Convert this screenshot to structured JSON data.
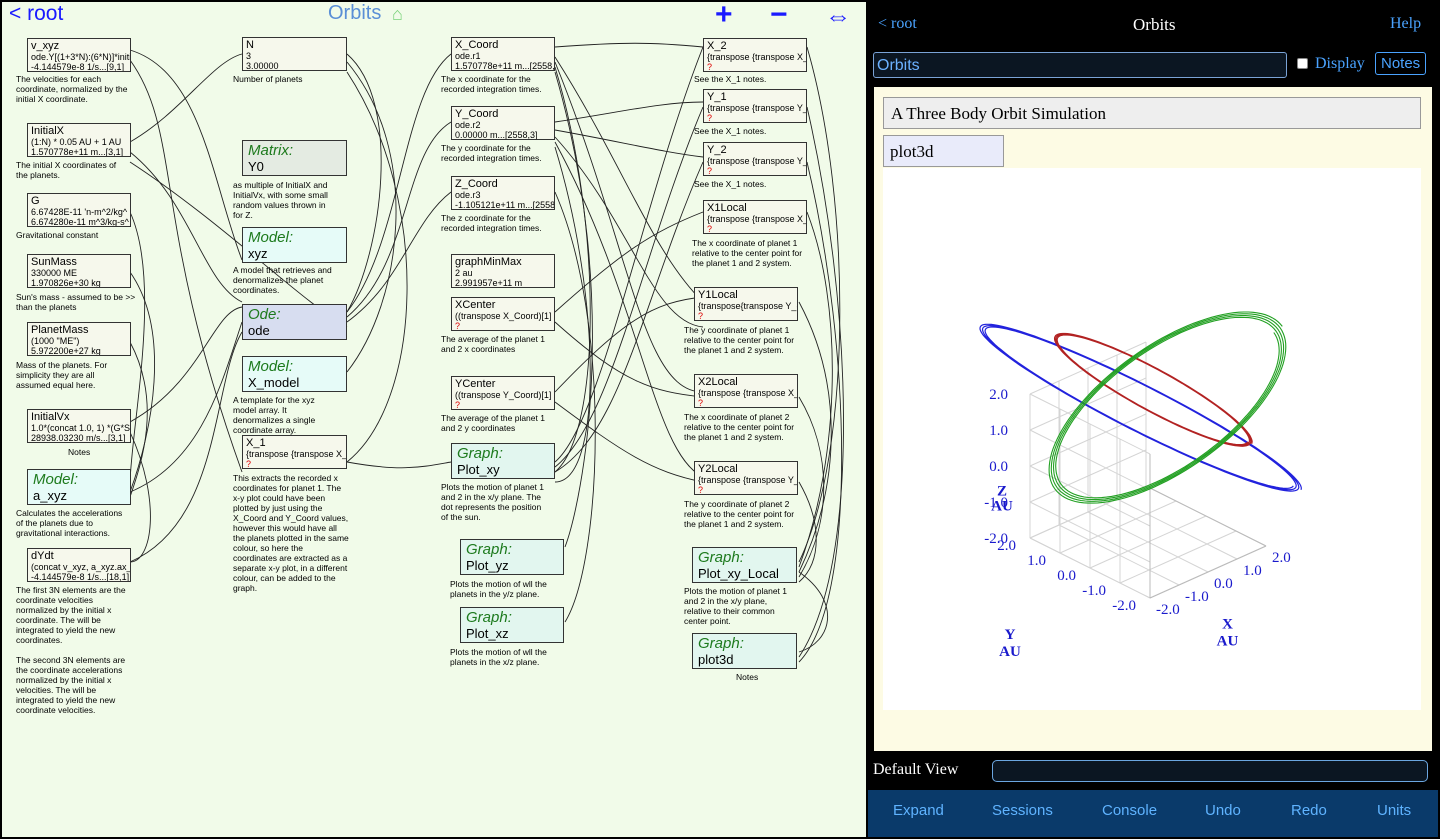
{
  "diagram": {
    "root_link": "< root",
    "title": "Orbits",
    "home_icon": "house-icon",
    "zoom_in": "+",
    "zoom_out": "−",
    "expand": "⇔",
    "nodes": {
      "v_xyz": {
        "name": "v_xyz",
        "l1": "ode.Y[(1+3*N):(6*N)]*initi",
        "l2": "-4.144579e-8 1/s...[9,1]",
        "note": "The velocities for each coordinate, normalized by the initial X coordinate."
      },
      "initialx": {
        "name": "InitialX",
        "l1": "(1:N) * 0.05 AU + 1 AU",
        "l2": "1.570778e+11 m...[3,1]",
        "note": "The initial X coordinates of the planets."
      },
      "g": {
        "name": "G",
        "l1": "6.67428E-11 'n-m^2/kg^",
        "l2": "6.674280e-11 m^3/kg-s^",
        "note": "Gravitational constant"
      },
      "sunmass": {
        "name": "SunMass",
        "l1": "330000 ME",
        "l2": "1.970826e+30 kg",
        "note": "Sun's mass - assumed to be >> than the planets"
      },
      "planetmass": {
        "name": "PlanetMass",
        "l1": "(1000 \"ME\")",
        "l2": "5.972200e+27 kg",
        "note": "Mass of the planets. For simplicity they are all assumed equal here."
      },
      "initialvx": {
        "name": "InitialVx",
        "l1": "1.0*(concat 1.0, 1) *(G*Su",
        "l2": "28938.03230 m/s...[3,1]",
        "note": "Notes"
      },
      "a_xyz": {
        "kind": "Model:",
        "name": "a_xyz",
        "note": "Calculates the accelerations of the planets due to gravitational interactions."
      },
      "dydt": {
        "name": "dYdt",
        "l1": "(concat v_xyz, a_xyz.ax_",
        "l2": "-4.144579e-8 1/s...[18,1]",
        "note": "The first 3N elements are the coordinate velocities normalized by the initial x coordinate. The will be integrated to yield the new coordinates.\n\nThe second 3N elements are the coordinate accelerations normalized by the initial x velocities. The will be integrated to yield the new coordinate velocities."
      },
      "n": {
        "name": "N",
        "l1": "3",
        "l2": "3.00000",
        "note": "Number of planets"
      },
      "y0": {
        "kind": "Matrix:",
        "name": "Y0",
        "note": "as multiple of InitialX and InitialVx, with some small random values thrown in for Z."
      },
      "xyz": {
        "kind": "Model:",
        "name": "xyz",
        "note": "A model that retrieves and denormalizes the planet coordinates."
      },
      "ode": {
        "kind": "Ode:",
        "name": "ode"
      },
      "x_model": {
        "kind": "Model:",
        "name": "X_model",
        "note": "A template for the xyz model array. It denormalizes a single coordinate array."
      },
      "x_1": {
        "name": "X_1",
        "l1": "{transpose {transpose X_",
        "q": "?",
        "note": "This extracts the recorded x coordinates for planet 1. The x-y plot could have been plotted by just using the X_Coord and Y_Coord values, however this would have all the planets plotted in the same colour, so here the coordinates are extracted as a separate x-y plot, in a different colour, can be added to the graph."
      },
      "x_coord": {
        "name": "X_Coord",
        "l1": "ode.r1",
        "l2": "1.570778e+11 m...[2558,",
        "note": "The x coordinate for the recorded integration times."
      },
      "y_coord": {
        "name": "Y_Coord",
        "l1": "ode.r2",
        "l2": "0.00000 m...[2558,3]",
        "note": "The y coordinate for the recorded integration times."
      },
      "z_coord": {
        "name": "Z_Coord",
        "l1": "ode.r3",
        "l2": "-1.105121e+11 m...[2558",
        "note": "The z coordinate for the recorded integration times."
      },
      "graphminmax": {
        "name": "graphMinMax",
        "l1": "2 au",
        "l2": "2.991957e+11 m"
      },
      "xcenter": {
        "name": "XCenter",
        "l1": "((transpose X_Coord)[1]",
        "q": "?",
        "note": "The average of the planet 1 and 2 x coordinates"
      },
      "ycenter": {
        "name": "YCenter",
        "l1": "((transpose Y_Coord)[1]",
        "q": "?",
        "note": "The average of the planet 1 and 2 y coordinates"
      },
      "plot_xy": {
        "kind": "Graph:",
        "name": "Plot_xy",
        "note": "Plots the motion of planet 1 and 2 in the x/y plane. The dot represents the position of the sun."
      },
      "plot_yz": {
        "kind": "Graph:",
        "name": "Plot_yz",
        "note": "Plots the motion of wll the planets in the y/z plane."
      },
      "plot_xz": {
        "kind": "Graph:",
        "name": "Plot_xz",
        "note": "Plots the motion of wll the planets in the x/z plane."
      },
      "x_2": {
        "name": "X_2",
        "l1": "{transpose {transpose X_(",
        "q": "?",
        "note": "See the X_1 notes."
      },
      "y_1": {
        "name": "Y_1",
        "l1": "{transpose {transpose Y_(",
        "q": "?",
        "note": "See the X_1 notes."
      },
      "y_2": {
        "name": "Y_2",
        "l1": "{transpose {transpose Y_(",
        "q": "?",
        "note": "See the X_1 notes."
      },
      "x1local": {
        "name": "X1Local",
        "l1": "{transpose {transpose X_(",
        "q": "?",
        "note": "The x coordinate of planet 1 relative to the center point for the planet 1 and 2 system."
      },
      "y1local": {
        "name": "Y1Local",
        "l1": "{transpose{transpose Y_(",
        "q": "?",
        "note": "The y coordinate of planet 1 relative to the center point for the planet 1 and 2 system."
      },
      "x2local": {
        "name": "X2Local",
        "l1": "{transpose {transpose X_(",
        "q": "?",
        "note": "The x coordinate of planet 2 relative to the center point for the planet 1 and 2 system."
      },
      "y2local": {
        "name": "Y2Local",
        "l1": "{transpose {transpose Y_(",
        "q": "?",
        "note": "The y coordinate of planet 2 relative to the center point for the planet 1 and 2 system."
      },
      "plot_xy_local": {
        "kind": "Graph:",
        "name": "Plot_xy_Local",
        "note": "Plots the motion of planet 1 and 2 in the x/y plane, relative to their common center point."
      },
      "plot3d": {
        "kind": "Graph:",
        "name": "plot3d",
        "note": "Notes"
      }
    }
  },
  "panel": {
    "root_link": "< root",
    "title": "Orbits",
    "help": "Help",
    "title_field": "Orbits",
    "display_label": "Display",
    "display_checked": false,
    "notes_button": "Notes",
    "doc_title": "A Three Body Orbit Simulation",
    "plot_tab": "plot3d",
    "default_view_label": "Default View",
    "default_view_value": "",
    "bottom": {
      "expand": "Expand",
      "sessions": "Sessions",
      "console": "Console",
      "undo": "Undo",
      "redo": "Redo",
      "units": "Units"
    }
  },
  "chart_data": {
    "type": "3d-line",
    "z_ticks": [
      "2.0",
      "1.0",
      "0.0",
      "-1.0",
      "-2.0"
    ],
    "y_ticks": [
      "2.0",
      "1.0",
      "0.0",
      "-1.0",
      "-2.0"
    ],
    "x_ticks": [
      "-2.0",
      "-1.0",
      "0.0",
      "1.0",
      "2.0"
    ],
    "zlabel": [
      "Z",
      "AU"
    ],
    "ylabel": [
      "Y",
      "AU"
    ],
    "xlabel": [
      "X",
      "AU"
    ],
    "series_colors": [
      "#2222dd",
      "#b22222",
      "#22a022"
    ],
    "axis_label_color": "#1a1acc"
  }
}
